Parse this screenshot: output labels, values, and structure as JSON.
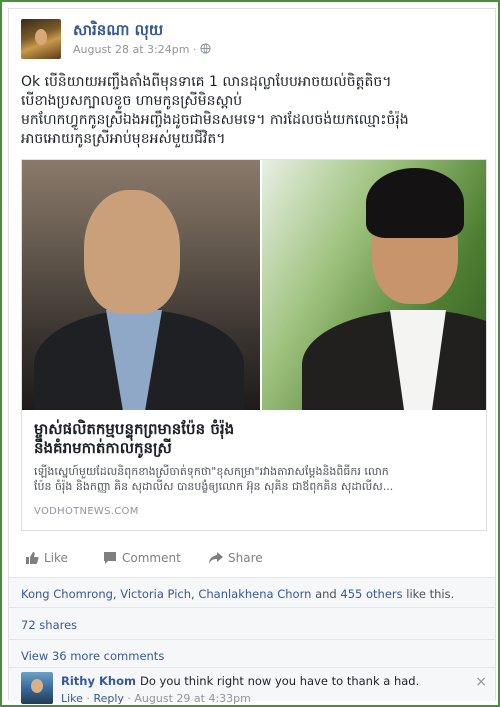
{
  "post": {
    "author": "សារិនណា លុយ",
    "date": "August 28 at 3:24pm",
    "separator": "·",
    "text_lines": [
      "Ok បើនិយាយអញ្ចឹងតាំងពីមុនទាគេ 1 លានដុល្លាបែបអាចយល់ចិត្តតិច។",
      "បើខាងប្រសក្បាលខូច ហាមកូនស្រីមិនស្តាប់",
      "មកហែកហ្វូកកូនស្រីឯងអញ្ចឹងដូចជាមិនសមទេ។ ការដែលចង់យកឈ្មោះចំរ៉ុង",
      "អាចអោយកូនស្រីអាប់មុខអស់មួយជីវិត។"
    ]
  },
  "link": {
    "title_lines": [
      "ម្ចាស់ផលិតកម្មបន្ទុកព្រមានប៉ែន ចំរ៉ុង",
      "នឹងគំរាមកាត់កាលកូនស្រី"
    ],
    "description_lines": [
      "ឡើងស្នេហ៍មួយដែលនិពុកខាងស្រីចាត់ទុកថា\"ខុសកម្រា\"រវាងតារាសម្តែងនិងពិធីករ លោក",
      "ប៉ែន ចំរ៉ុង និងកញ្ញា គិន សុដាលីស បានបង្ខំឲ្យលោក អ៊ុន សុគិន ជាឪពុកគិន សុដាលីស..."
    ],
    "domain": "VODHOTNEWS.COM"
  },
  "actions": {
    "like": "Like",
    "comment": "Comment",
    "share": "Share"
  },
  "likes": {
    "names": [
      "Kong Chomrong",
      "Victoria Pich",
      "Chanlakhena Chorn"
    ],
    "sep1": ", ",
    "sep2": ", ",
    "and": " and ",
    "others": "455 others",
    "suffix": " like this."
  },
  "shares": "72 shares",
  "more_comments": "View 36 more comments",
  "comment": {
    "author": "Rithy Khom",
    "text": "Do you think right now you have to thank a had.",
    "like": "Like",
    "reply": "Reply",
    "dot1": " · ",
    "dot2": " · ",
    "date": "August 29 at 4:33pm",
    "close": "×"
  },
  "colors": {
    "link_blue": "#365899",
    "meta_grey": "#90949c",
    "frame_green": "#4a8f3a"
  },
  "icons": [
    "globe-icon",
    "like-icon",
    "comment-icon",
    "share-icon",
    "close-icon"
  ]
}
